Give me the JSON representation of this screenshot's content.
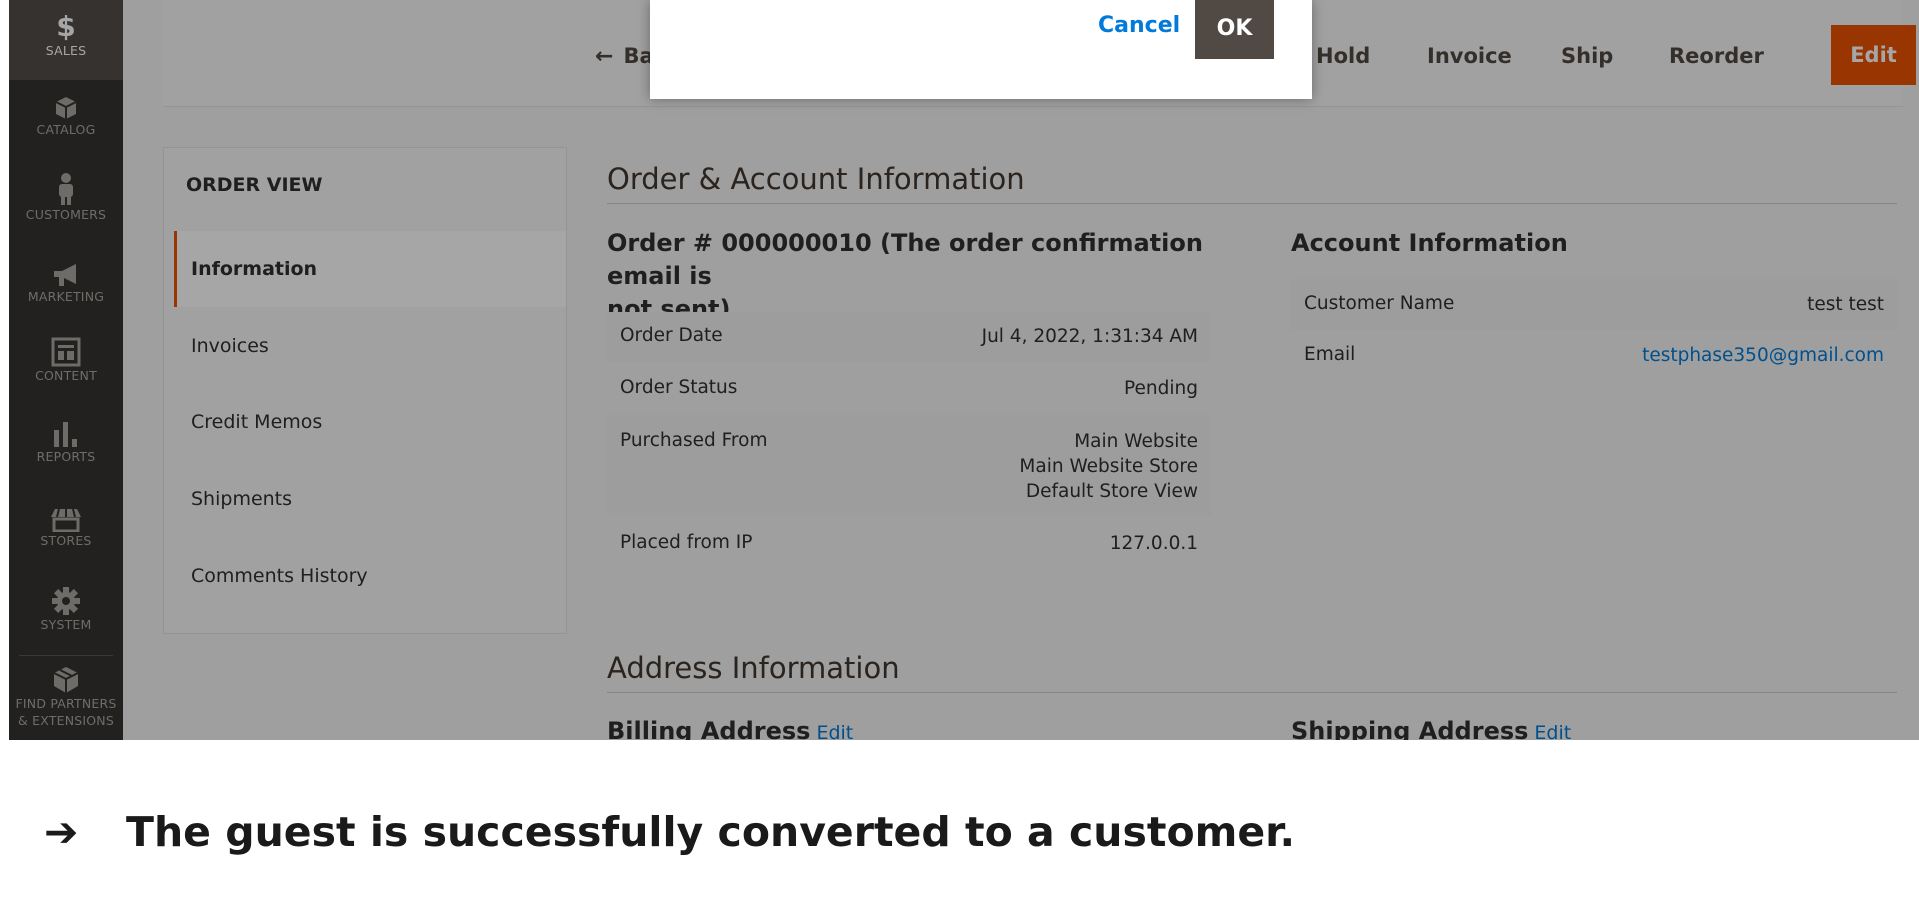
{
  "sidebar": {
    "items": [
      {
        "label": "SALES",
        "icon": "dollar-icon",
        "glyph": "$"
      },
      {
        "label": "CATALOG",
        "icon": "cube-icon"
      },
      {
        "label": "CUSTOMERS",
        "icon": "person-icon"
      },
      {
        "label": "MARKETING",
        "icon": "megaphone-icon"
      },
      {
        "label": "CONTENT",
        "icon": "layout-icon"
      },
      {
        "label": "REPORTS",
        "icon": "bar-chart-icon"
      },
      {
        "label": "STORES",
        "icon": "storefront-icon"
      },
      {
        "label": "SYSTEM",
        "icon": "gear-icon"
      }
    ],
    "partners_line1": "FIND PARTNERS",
    "partners_line2": "& EXTENSIONS"
  },
  "actions": {
    "back": "Back",
    "back_arrow": "←",
    "hold": "Hold",
    "invoice": "Invoice",
    "ship": "Ship",
    "reorder": "Reorder",
    "edit": "Edit"
  },
  "modal": {
    "cancel": "Cancel",
    "ok": "OK"
  },
  "order_view": {
    "title": "ORDER VIEW",
    "tabs": [
      "Information",
      "Invoices",
      "Credit Memos",
      "Shipments",
      "Comments History"
    ]
  },
  "order_info": {
    "section_title": "Order & Account Information",
    "order_heading_line1": "Order # 000000010 (The order confirmation email is",
    "order_heading_line2": "not sent)",
    "rows": {
      "date_label": "Order Date",
      "date_value": "Jul 4, 2022, 1:31:34 AM",
      "status_label": "Order Status",
      "status_value": "Pending",
      "purchased_label": "Purchased From",
      "purchased_line1": "Main Website",
      "purchased_line2": "Main Website Store",
      "purchased_line3": "Default Store View",
      "ip_label": "Placed from IP",
      "ip_value": "127.0.0.1"
    }
  },
  "account_info": {
    "heading": "Account Information",
    "name_label": "Customer Name",
    "name_value": "test test",
    "email_label": "Email",
    "email_value": "testphase350@gmail.com"
  },
  "address_info": {
    "section_title": "Address Information",
    "billing": "Billing Address",
    "shipping": "Shipping Address",
    "edit": "Edit"
  },
  "caption": {
    "arrow": "➔",
    "text": "The guest is successfully converted to a customer."
  },
  "colors": {
    "sidebar_bg": "#373330",
    "accent": "#eb5202",
    "link": "#007bdb",
    "primary_button": "#514943"
  }
}
